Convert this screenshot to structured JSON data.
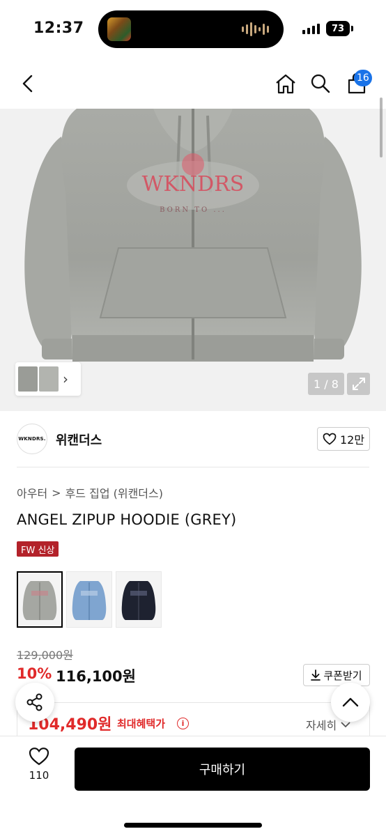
{
  "status_bar": {
    "time": "12:37",
    "battery": "73"
  },
  "nav": {
    "cart_count": "16",
    "icons": [
      "back-icon",
      "home-icon",
      "search-icon",
      "cart-icon"
    ]
  },
  "gallery": {
    "counter": "1 / 8"
  },
  "brand": {
    "logo_text": "WKNDRS.",
    "name": "위캔더스",
    "likes": "12만"
  },
  "breadcrumb": {
    "items": [
      "아우터",
      "후드 집업 (위캔더스)"
    ],
    "separator": ">"
  },
  "product": {
    "title": "ANGEL ZIPUP HOODIE (GREY)",
    "badge": "FW 신상",
    "color_options": [
      "grey",
      "blue",
      "black"
    ]
  },
  "price": {
    "original": "129,000원",
    "discount": "10%",
    "sale": "116,100원",
    "coupon_label": "쿠폰받기",
    "benefit_price": "104,490원",
    "benefit_label": "최대혜택가",
    "detail_label": "자세히"
  },
  "bottom": {
    "wish_count": "110",
    "buy_label": "구매하기"
  },
  "colors": {
    "accent_red": "#e02a2a",
    "badge_red": "#b3222a",
    "badge_blue": "#1a73e8",
    "buy_bg": "#000000"
  }
}
